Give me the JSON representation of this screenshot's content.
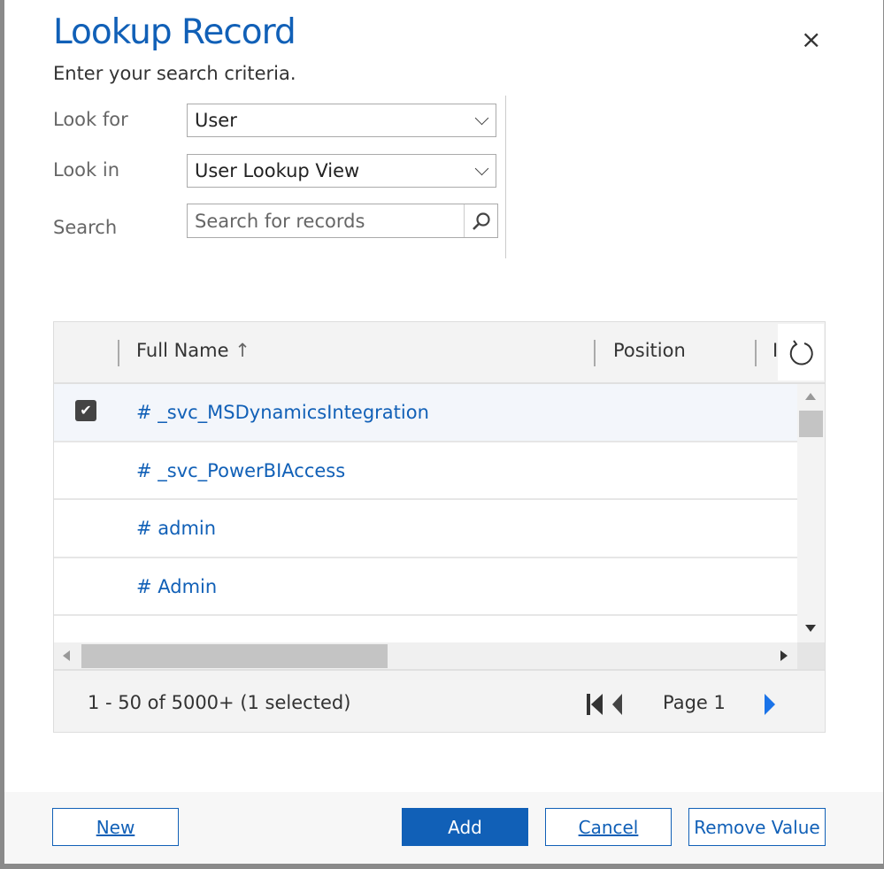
{
  "dialog": {
    "title": "Lookup Record",
    "subtitle": "Enter your search criteria.",
    "close": "×"
  },
  "form": {
    "look_for_label": "Look for",
    "look_for_value": "User",
    "look_in_label": "Look in",
    "look_in_value": "User Lookup View",
    "search_label": "Search",
    "search_placeholder": "Search for records"
  },
  "grid": {
    "columns": [
      "Full Name",
      "Position",
      "I"
    ],
    "sort_indicator": "↑",
    "rows": [
      {
        "name": "# _svc_MSDynamicsIntegration",
        "selected": true
      },
      {
        "name": "# _svc_PowerBIAccess",
        "selected": false
      },
      {
        "name": "# admin",
        "selected": false
      },
      {
        "name": "# Admin",
        "selected": false
      }
    ],
    "status": "1 - 50 of 5000+ (1 selected)",
    "page": "Page 1"
  },
  "buttons": {
    "new": "New",
    "add": "Add",
    "cancel": "Cancel",
    "remove": "Remove Value"
  },
  "colors": {
    "accent": "#1160b7"
  }
}
